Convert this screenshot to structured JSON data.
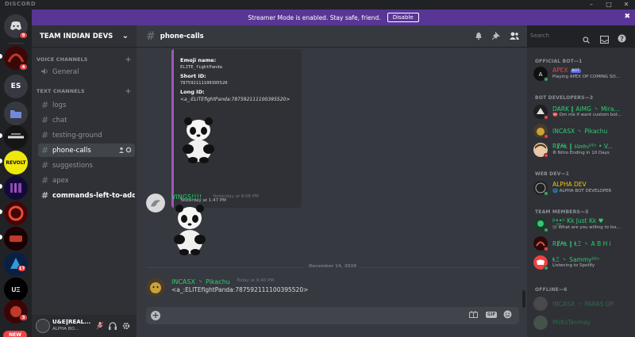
{
  "titlebar": {
    "brand": "DISCORD",
    "minimize": "–",
    "maximize": "□",
    "close": "✕"
  },
  "banner": {
    "text": "Streamer Mode is enabled. Stay safe, friend.",
    "button": "Disable",
    "close": "✖"
  },
  "rail": {
    "home_badge": "9",
    "server1_badge": "4",
    "es_label": "ES",
    "revolt_label": "REVOLT",
    "server_badge_17": "17",
    "server_badge_3": "3",
    "new_label": "NEW"
  },
  "server": {
    "name": "TEAM INDIAN DEVS",
    "chevron": "⌄"
  },
  "categories": {
    "voice": "VOICE CHANNELS",
    "text": "TEXT CHANNELS",
    "plus": "+"
  },
  "channels": {
    "general": "General",
    "logs": "logs",
    "chat": "chat",
    "testing_ground": "testing-ground",
    "phone_calls": "phone-calls",
    "suggestions": "suggestions",
    "apex": "apex",
    "commands": "commands-left-to-add-in..."
  },
  "user": {
    "name": "U&E‖REAL...",
    "status": "ALPHA BO..."
  },
  "header": {
    "channel": "phone-calls",
    "search_placeholder": "Search"
  },
  "embed": {
    "emoji_name_label": "Emoji name:",
    "emoji_name_value": "ELITE_fightPanda",
    "short_id_label": "Short ID:",
    "short_id_value": "787592111100395520",
    "long_id_label": "Long ID:",
    "long_id_value": "<a_:ELITEfightPanda:787592111100395520>",
    "footer": "Yesterday at 1:47 PM"
  },
  "messages": [
    {
      "author": "VINGS!!!!",
      "timestamp": "Yesterday at 8:06 PM",
      "author_color": "#2ecc71"
    },
    {
      "author": "INCASX 丶 Pikachu ",
      "timestamp": "Today at 8:40 PM",
      "text": "<a_:ELITEfightPanda:787592111100395520>",
      "author_color": "#2ecc71"
    }
  ],
  "divider": "December 14, 2020",
  "composer": {
    "value": "",
    "gif": "GIF"
  },
  "members": {
    "official_bot": "OFFICIAL BOT—1",
    "bot_developers": "BOT DEVELOPERS—3",
    "web_dev": "WEB DEV—1",
    "team_members": "TEAM MEMBERS—3",
    "offline": "OFFLINE—6",
    "bot_badge": "BOT",
    "list": [
      {
        "name": "APEX",
        "status": "Playing APEX OP COMING SO...",
        "color": "#ed4245"
      },
      {
        "name": "DARK ‖ AiMG 丶 Mira...",
        "status": "⛔ Dm me if want custom bot...",
        "color": "#2ecc71"
      },
      {
        "name": "INCASX 丶 Pikachu ",
        "status": "",
        "color": "#2ecc71"
      },
      {
        "name": "RɆ₳Ⱡ ‖ 𝔟𝔩𝔬𝔬𝔡𝔶ᴰᴱᵛ • V...",
        "status": "⚙ Nitro Ending In 10 Days",
        "color": "#2ecc71"
      },
      {
        "name": "ALPHA DEV",
        "status": "🌐 ALPHA BOT DEVELOPER",
        "color": "#f1c40f"
      },
      {
        "name": "ᵁ̷•͜•ᵁ Kk Just Kk ♥",
        "status": "😕 What are you willing to los...",
        "color": "#2ecc71"
      },
      {
        "name": "RɆ₳Ⱡ ‖ ⱠΞ 丶 A B H i",
        "status": "",
        "color": "#2ecc71"
      },
      {
        "name": "ⱠΞ 丶 Sammyᴰᴱᵛ",
        "status": "Listening to Spotify",
        "color": "#2ecc71"
      },
      {
        "name": "INCASX 丶 PARAS OP",
        "status": "",
        "color": "#2ecc71"
      },
      {
        "name": "MsKsTanmay",
        "status": "",
        "color": "#2ecc71"
      }
    ]
  },
  "colors": {
    "accent": "#593695",
    "online": "#3ba55d",
    "dnd": "#ed4245",
    "idle": "#faa81a",
    "embed_bar": "#9b59b6"
  }
}
